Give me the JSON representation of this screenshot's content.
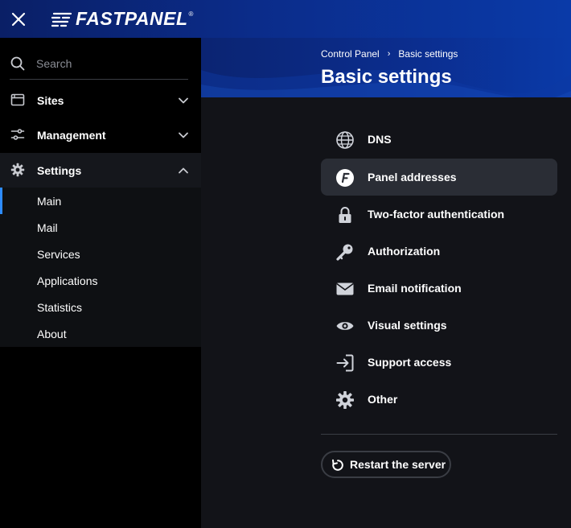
{
  "app": {
    "brand": "FASTPANEL",
    "brand_mark": "®"
  },
  "sidebar": {
    "search_placeholder": "Search",
    "items": [
      {
        "label": "Sites",
        "icon": "window-icon",
        "expanded": false
      },
      {
        "label": "Management",
        "icon": "sliders-icon",
        "expanded": false
      },
      {
        "label": "Settings",
        "icon": "gear-icon",
        "expanded": true
      }
    ],
    "settings_submenu": [
      "Main",
      "Mail",
      "Services",
      "Applications",
      "Statistics",
      "About"
    ],
    "active_submenu": "Main"
  },
  "header": {
    "breadcrumb": [
      "Control Panel",
      "Basic settings"
    ],
    "title": "Basic settings"
  },
  "settings_menu": [
    {
      "label": "DNS",
      "icon": "globe-icon"
    },
    {
      "label": "Panel addresses",
      "icon": "panel-f-icon",
      "active": true
    },
    {
      "label": "Two-factor authentication",
      "icon": "lock-icon"
    },
    {
      "label": "Authorization",
      "icon": "key-icon"
    },
    {
      "label": "Email notification",
      "icon": "envelope-icon"
    },
    {
      "label": "Visual settings",
      "icon": "eye-icon"
    },
    {
      "label": "Support access",
      "icon": "enter-arrow-icon"
    },
    {
      "label": "Other",
      "icon": "gear-icon"
    }
  ],
  "actions": {
    "restart_label": "Restart the server"
  },
  "colors": {
    "accent": "#2d8cff",
    "topbar": "#0b2c8a",
    "active_bg": "#2a2d35"
  }
}
